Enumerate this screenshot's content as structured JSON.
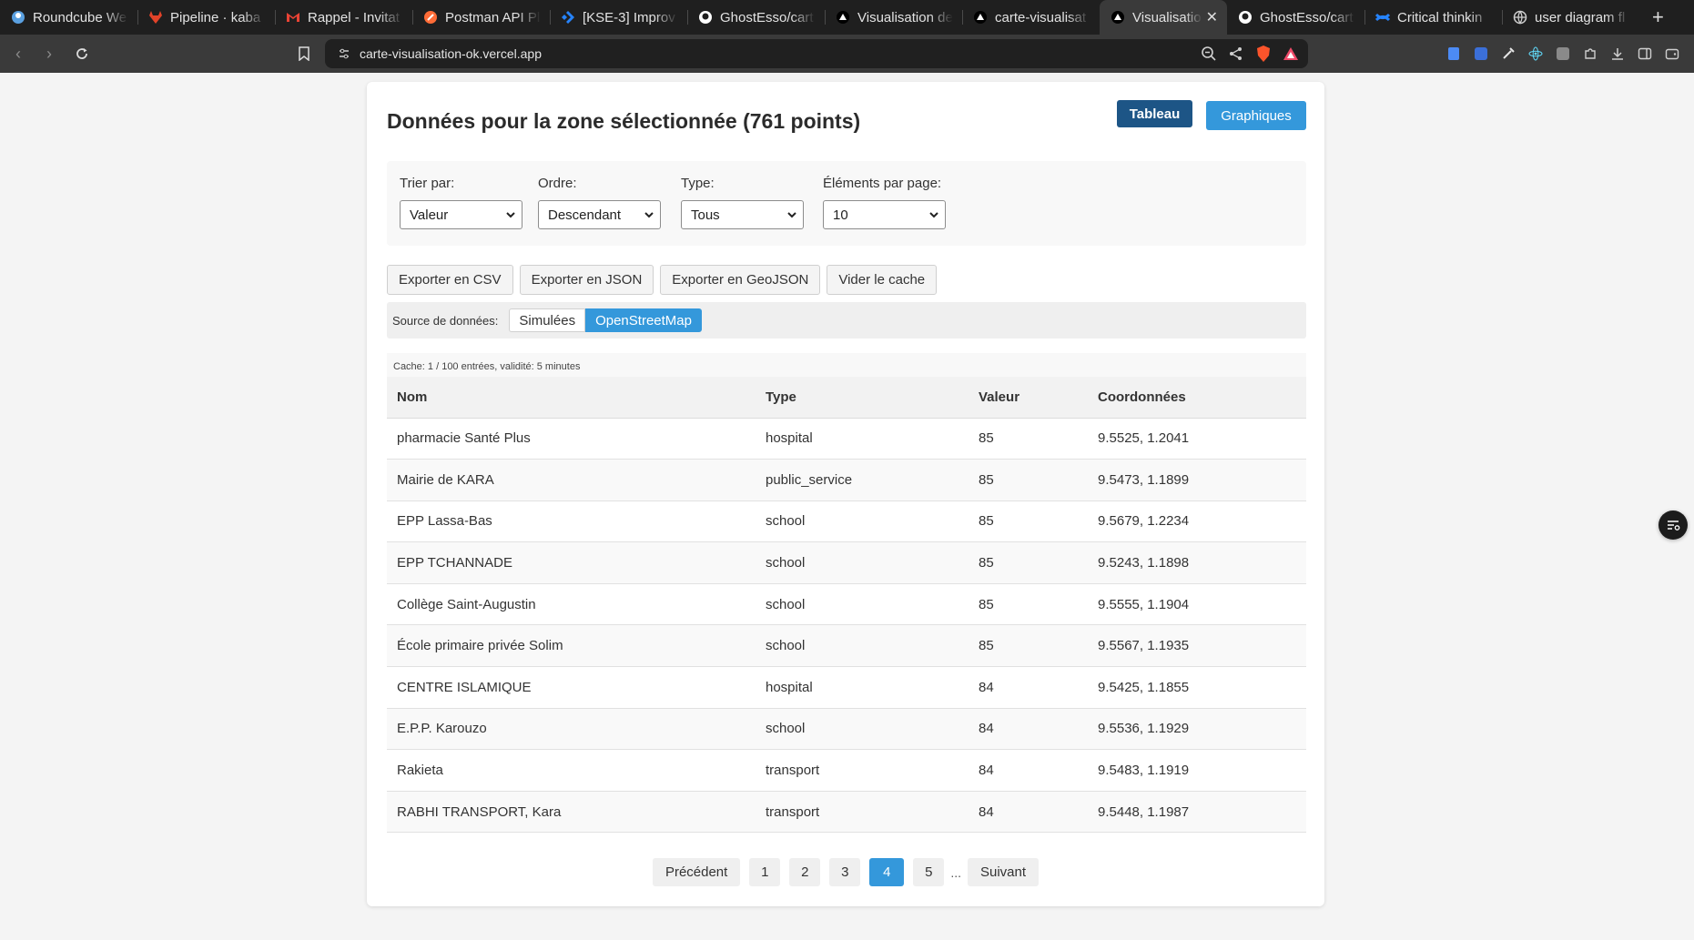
{
  "browser": {
    "tabs": [
      {
        "title": "Roundcube We",
        "icon": "roundcube-icon",
        "color": "#5aa0e0"
      },
      {
        "title": "Pipeline · kaba",
        "icon": "gitlab-icon",
        "color": "#e24329"
      },
      {
        "title": "Rappel - Invitat",
        "icon": "gmail-icon",
        "color": "#ea4335"
      },
      {
        "title": "Postman API Pl",
        "icon": "postman-icon",
        "color": "#ff6c37"
      },
      {
        "title": "[KSE-3] Improv",
        "icon": "jira-icon",
        "color": "#2684ff"
      },
      {
        "title": "GhostEsso/cart",
        "icon": "github-icon",
        "color": "#ffffff"
      },
      {
        "title": "Visualisation de",
        "icon": "vercel-icon",
        "color": "#ffffff"
      },
      {
        "title": "carte-visualisat",
        "icon": "vercel-icon",
        "color": "#ffffff"
      },
      {
        "title": "Visualisatio",
        "icon": "vercel-icon",
        "color": "#ffffff",
        "active": true
      },
      {
        "title": "GhostEsso/cart",
        "icon": "github-icon",
        "color": "#ffffff"
      },
      {
        "title": "Critical thinkin",
        "icon": "confluence-icon",
        "color": "#2684ff"
      },
      {
        "title": "user diagram fl",
        "icon": "globe-icon",
        "color": "#cfcfcf"
      }
    ],
    "url": "carte-visualisation-ok.vercel.app"
  },
  "page": {
    "title": "Données pour la zone sélectionnée (761 points)",
    "view_buttons": {
      "table": "Tableau",
      "charts": "Graphiques"
    },
    "filters": {
      "sort_by": {
        "label": "Trier par:",
        "value": "Valeur"
      },
      "order": {
        "label": "Ordre:",
        "value": "Descendant"
      },
      "type": {
        "label": "Type:",
        "value": "Tous"
      },
      "per_page": {
        "label": "Éléments par page:",
        "value": "10"
      }
    },
    "actions": {
      "csv": "Exporter en CSV",
      "json": "Exporter en JSON",
      "geojson": "Exporter en GeoJSON",
      "clear_cache": "Vider le cache"
    },
    "source": {
      "label": "Source de données:",
      "options": [
        "Simulées",
        "OpenStreetMap"
      ],
      "selected": "OpenStreetMap"
    },
    "cache_info": "Cache: 1 / 100 entrées, validité: 5 minutes",
    "table": {
      "columns": [
        "Nom",
        "Type",
        "Valeur",
        "Coordonnées"
      ],
      "rows": [
        [
          "pharmacie Santé Plus",
          "hospital",
          "85",
          "9.5525, 1.2041"
        ],
        [
          "Mairie de KARA",
          "public_service",
          "85",
          "9.5473, 1.1899"
        ],
        [
          "EPP Lassa-Bas",
          "school",
          "85",
          "9.5679, 1.2234"
        ],
        [
          "EPP TCHANNADE",
          "school",
          "85",
          "9.5243, 1.1898"
        ],
        [
          "Collège Saint-Augustin",
          "school",
          "85",
          "9.5555, 1.1904"
        ],
        [
          "École primaire privée Solim",
          "school",
          "85",
          "9.5567, 1.1935"
        ],
        [
          "CENTRE ISLAMIQUE",
          "hospital",
          "84",
          "9.5425, 1.1855"
        ],
        [
          "E.P.P. Karouzo",
          "school",
          "84",
          "9.5536, 1.1929"
        ],
        [
          "Rakieta",
          "transport",
          "84",
          "9.5483, 1.1919"
        ],
        [
          "RABHI TRANSPORT, Kara",
          "transport",
          "84",
          "9.5448, 1.1987"
        ]
      ]
    },
    "pagination": {
      "previous": "Précédent",
      "pages": [
        "1",
        "2",
        "3",
        "4",
        "5"
      ],
      "current": "4",
      "ellipsis": "...",
      "next": "Suivant"
    }
  },
  "colors": {
    "primary": "#3498db",
    "primary_dark": "#1d5586"
  }
}
